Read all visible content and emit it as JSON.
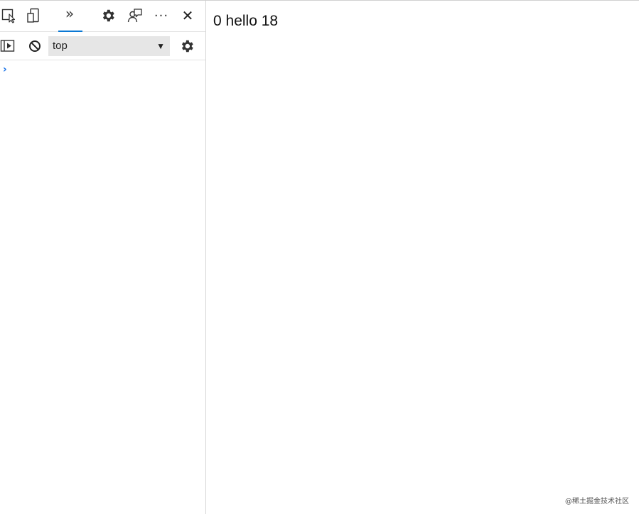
{
  "devtools": {
    "toolbar": {
      "inspect_icon": "inspect-element-icon",
      "device_icon": "device-emulation-icon",
      "more_tabs_glyph": "»",
      "settings_icon": "gear-icon",
      "feedback_icon": "feedback-icon",
      "more_glyph": "···",
      "close_glyph": "✕"
    },
    "console_toolbar": {
      "sidebar_icon": "console-sidebar-icon",
      "clear_icon": "clear-console-icon",
      "context_value": "top",
      "settings_icon": "gear-icon"
    },
    "prompt_glyph": "›"
  },
  "page": {
    "text": "0 hello 18"
  },
  "watermark": "@稀土掘金技术社区",
  "colors": {
    "accent": "#0a78d4",
    "prompt": "#1a73e8"
  }
}
